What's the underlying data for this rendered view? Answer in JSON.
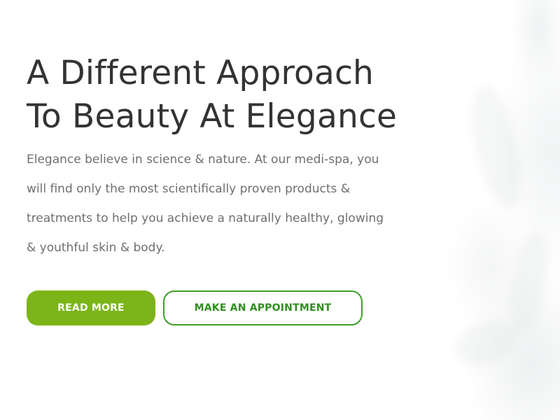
{
  "hero": {
    "headline_lines": [
      "A Different Approach",
      "To Beauty At Elegance"
    ],
    "description_lines": [
      "Elegance believe in science & nature. At our medi-spa, you",
      "will find only the most scientifically proven products &",
      "treatments to help you achieve a naturally healthy, glowing",
      "& youthful skin & body."
    ],
    "buttons": {
      "read_more": "READ MORE",
      "appointment": "MAKE AN APPOINTMENT"
    }
  },
  "colors": {
    "primary_green": "#7cb518",
    "outline_green": "#3f9f2b",
    "heading": "#333333",
    "body_text": "#6f6f6f"
  }
}
